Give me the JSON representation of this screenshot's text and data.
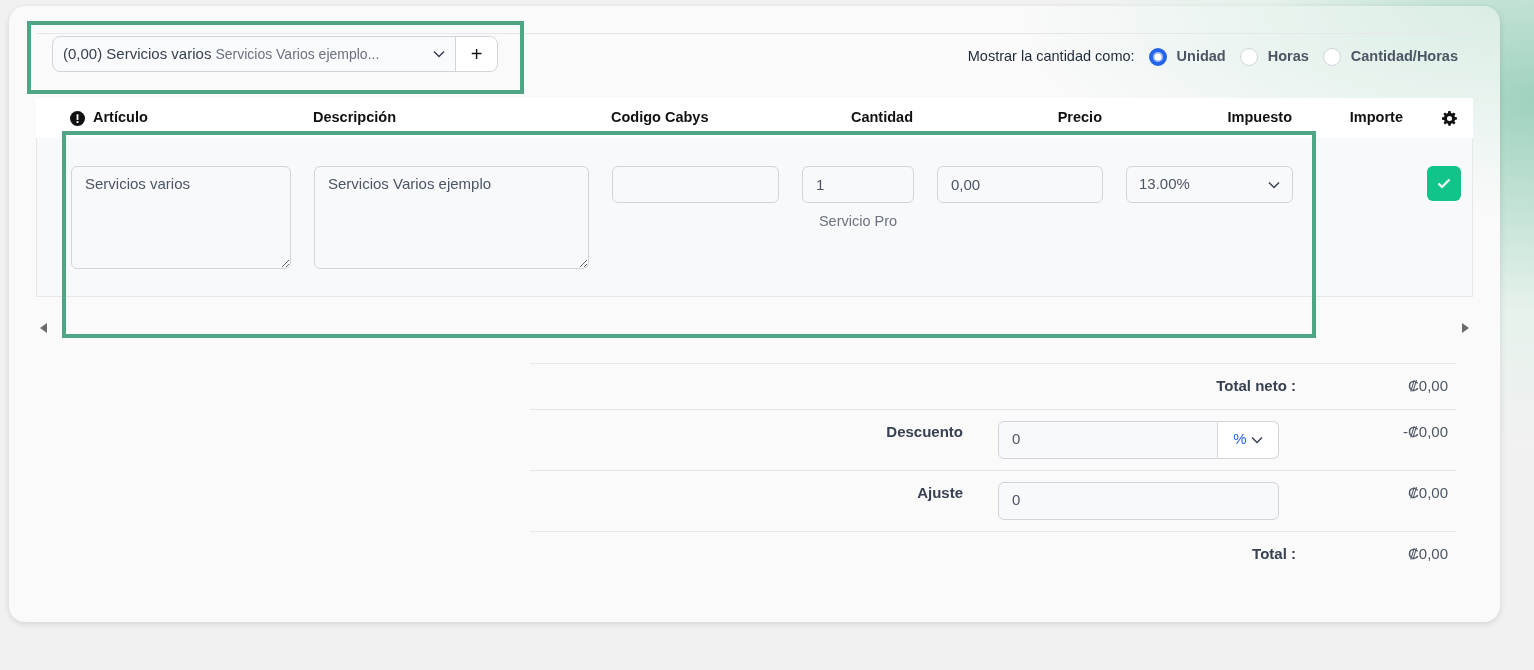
{
  "product_picker": {
    "value": "(0,00) Servicios varios",
    "description": "Servicios Varios ejemplo...",
    "add_button": "+"
  },
  "quantity_mode": {
    "label": "Mostrar la cantidad como:",
    "options": [
      {
        "label": "Unidad",
        "selected": true
      },
      {
        "label": "Horas",
        "selected": false
      },
      {
        "label": "Cantidad/Horas",
        "selected": false
      }
    ]
  },
  "table": {
    "columns": [
      "Artículo",
      "Descripción",
      "Codigo Cabys",
      "Cantidad",
      "Precio",
      "Impuesto",
      "Importe"
    ],
    "rows": [
      {
        "articulo": "Servicios varios",
        "descripcion": "Servicios Varios ejemplo",
        "cantidad": "1",
        "unidad": "Servicio Pro",
        "precio": "0,00",
        "impuesto": "13.00%"
      }
    ]
  },
  "totals": [
    {
      "kind": "total",
      "label": "Total neto :",
      "amount": "₡0,00"
    },
    {
      "kind": "discount",
      "label": "Descuento",
      "value": "0",
      "unit": "%",
      "amount": "-₡0,00"
    },
    {
      "kind": "input",
      "label": "Ajuste",
      "value": "0",
      "amount": "₡0,00"
    },
    {
      "kind": "total",
      "label": "Total :",
      "amount": "₡0,00"
    }
  ]
}
